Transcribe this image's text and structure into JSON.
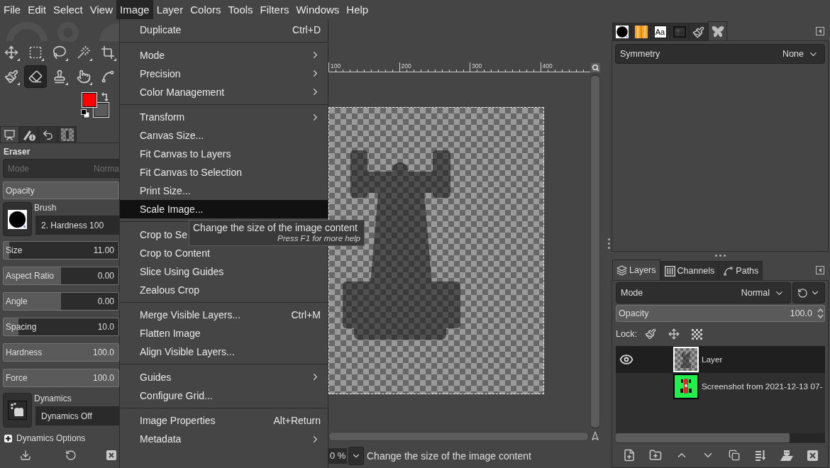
{
  "menubar": [
    {
      "label": "File",
      "selected": false
    },
    {
      "label": "Edit",
      "selected": false
    },
    {
      "label": "Select",
      "selected": false
    },
    {
      "label": "View",
      "selected": false
    },
    {
      "label": "Image",
      "selected": true
    },
    {
      "label": "Layer",
      "selected": false
    },
    {
      "label": "Colors",
      "selected": false
    },
    {
      "label": "Tools",
      "selected": false
    },
    {
      "label": "Filters",
      "selected": false
    },
    {
      "label": "Windows",
      "selected": false
    },
    {
      "label": "Help",
      "selected": false
    }
  ],
  "toolbox": {
    "tools": [
      {
        "kind": "move",
        "grouped": true,
        "selected": false
      },
      {
        "kind": "rect-select",
        "grouped": true,
        "selected": false
      },
      {
        "kind": "lasso",
        "grouped": true,
        "selected": false
      },
      {
        "kind": "wand",
        "grouped": true,
        "selected": false
      },
      {
        "kind": "crop",
        "grouped": true,
        "selected": false
      },
      {
        "kind": "brush",
        "grouped": true,
        "selected": false
      },
      {
        "kind": "eraser",
        "grouped": false,
        "selected": true
      },
      {
        "kind": "stamp",
        "grouped": true,
        "selected": false
      },
      {
        "kind": "smudge",
        "grouped": true,
        "selected": false
      },
      {
        "kind": "paths",
        "grouped": false,
        "selected": false
      }
    ],
    "color_swatches": [
      {
        "kind": "foreground",
        "color": "#ff0000"
      },
      {
        "kind": "background",
        "color": "#5a5a5a"
      }
    ]
  },
  "dock_tabs": [
    {
      "kind": "tool-options",
      "selected": true
    },
    {
      "kind": "device-status",
      "selected": false
    },
    {
      "kind": "undo-history",
      "selected": false
    },
    {
      "kind": "images",
      "selected": false
    }
  ],
  "tool_options": {
    "title": "Eraser",
    "mode": {
      "label": "Mode",
      "value": "Norma",
      "disabled": true
    },
    "opacity": {
      "label": "Opacity",
      "level": 1
    },
    "brush": {
      "label": "Brush",
      "value": "2. Hardness 100"
    },
    "sliders": [
      {
        "label": "Size",
        "value": "11.00",
        "level": 0.05
      },
      {
        "label": "Aspect Ratio",
        "value": "0.00",
        "level": 0.5
      },
      {
        "label": "Angle",
        "value": "0.00",
        "level": 0.5
      },
      {
        "label": "Spacing",
        "value": "10.0",
        "level": 0.13
      },
      {
        "label": "Hardness",
        "value": "100.0",
        "level": 1
      },
      {
        "label": "Force",
        "value": "100.0",
        "level": 1
      }
    ],
    "dynamics": {
      "label": "Dynamics",
      "value": "Dynamics Off"
    },
    "dynamics_options": {
      "label": "Dynamics Options",
      "expanded": false
    }
  },
  "image_window": {
    "ruler_labels": [
      "100",
      "200",
      "300",
      "400"
    ],
    "zoom": "0 %",
    "status": "Change the size of the image content"
  },
  "right_dock": {
    "tabs": [
      {
        "kind": "brushes",
        "selected": false
      },
      {
        "kind": "gradients",
        "selected": false
      },
      {
        "kind": "fonts",
        "label": "Aa",
        "selected": false
      },
      {
        "kind": "patterns",
        "selected": false
      },
      {
        "kind": "paint-dynamics",
        "selected": false
      },
      {
        "kind": "symmetry",
        "selected": true
      }
    ],
    "symmetry": {
      "label": "Symmetry",
      "value": "None"
    }
  },
  "layers_dock": {
    "tabs": [
      {
        "kind": "layers",
        "label": "Layers",
        "selected": true
      },
      {
        "kind": "channels",
        "label": "Channels",
        "selected": false
      },
      {
        "kind": "paths",
        "label": "Paths",
        "selected": false
      }
    ],
    "mode": {
      "label": "Mode",
      "value": "Normal"
    },
    "opacity": {
      "label": "Opacity",
      "value": "100.0",
      "level": 1
    },
    "lock_label": "Lock:",
    "layers": [
      {
        "kind": "transparent",
        "name": "Layer",
        "visible": true,
        "selected": true
      },
      {
        "kind": "green",
        "name": "Screenshot from 2021-12-13 07-",
        "visible": false,
        "selected": false
      }
    ]
  },
  "image_menu": {
    "sections": [
      {
        "items": [
          {
            "kind": "command",
            "label": "Duplicate",
            "shortcut": "Ctrl+D",
            "selected": false
          }
        ]
      },
      {
        "items": [
          {
            "kind": "submenu",
            "label": "Mode",
            "selected": false
          },
          {
            "kind": "submenu",
            "label": "Precision",
            "selected": false
          },
          {
            "kind": "submenu",
            "label": "Color Management",
            "selected": false
          }
        ]
      },
      {
        "items": [
          {
            "kind": "submenu",
            "label": "Transform",
            "selected": false
          },
          {
            "kind": "command",
            "label": "Canvas Size...",
            "selected": false
          },
          {
            "kind": "command",
            "label": "Fit Canvas to Layers",
            "selected": false
          },
          {
            "kind": "command",
            "label": "Fit Canvas to Selection",
            "selected": false
          },
          {
            "kind": "command",
            "label": "Print Size...",
            "selected": false
          },
          {
            "kind": "command",
            "label": "Scale Image...",
            "selected": true
          }
        ]
      },
      {
        "items": [
          {
            "kind": "command",
            "label": "Crop to Se",
            "selected": false
          },
          {
            "kind": "command",
            "label": "Crop to Content",
            "selected": false
          },
          {
            "kind": "command",
            "label": "Slice Using Guides",
            "selected": false
          },
          {
            "kind": "command",
            "label": "Zealous Crop",
            "selected": false
          }
        ]
      },
      {
        "items": [
          {
            "kind": "command",
            "label": "Merge Visible Layers...",
            "shortcut": "Ctrl+M",
            "selected": false
          },
          {
            "kind": "command",
            "label": "Flatten Image",
            "selected": false
          },
          {
            "kind": "command",
            "label": "Align Visible Layers...",
            "selected": false
          }
        ]
      },
      {
        "items": [
          {
            "kind": "submenu",
            "label": "Guides",
            "selected": false
          },
          {
            "kind": "command",
            "label": "Configure Grid...",
            "selected": false
          }
        ]
      },
      {
        "items": [
          {
            "kind": "command",
            "label": "Image Properties",
            "shortcut": "Alt+Return",
            "selected": false
          },
          {
            "kind": "submenu",
            "label": "Metadata",
            "selected": false
          }
        ]
      }
    ]
  },
  "tooltip": {
    "text": "Change the size of the image content",
    "hint": "Press F1 for more help"
  }
}
